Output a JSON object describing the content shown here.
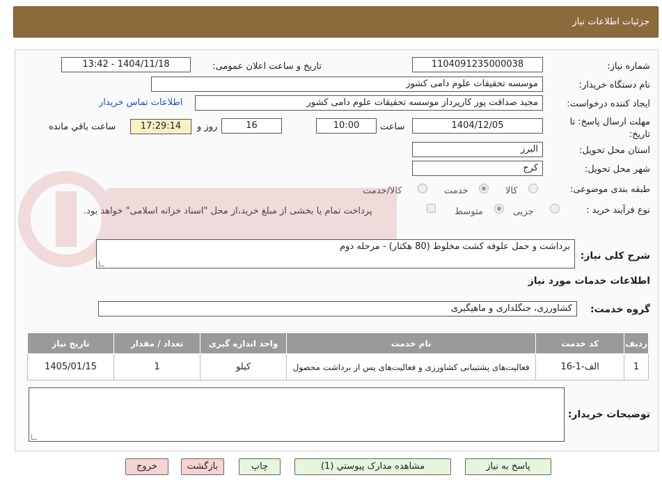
{
  "header": {
    "title": "جزئیات اطلاعات نیاز"
  },
  "form": {
    "need_number": {
      "label": "شماره نیاز:",
      "value": "1104091235000038"
    },
    "announce_datetime": {
      "label": "تاریخ و ساعت اعلان عمومی:",
      "value": "1404/11/18 - 13:42"
    },
    "buyer_org": {
      "label": "نام دستگاه خریدار:",
      "value": "موسسه تحقیقات علوم دامی کشور"
    },
    "requester": {
      "label": "ایجاد کننده درخواست:",
      "value": "مجید صداقت پور کارپرداز موسسه تحقیقات علوم دامی کشور"
    },
    "contact_link": "اطلاعات تماس خریدار",
    "deadline": {
      "label": "مهلت ارسال پاسخ: تا تاریخ:",
      "date": "1404/12/05",
      "time_label": "ساعت",
      "time": "10:00",
      "days": "16",
      "days_label": "روز و",
      "remaining": "17:29:14",
      "remaining_label": "ساعت باقي مانده"
    },
    "province": {
      "label": "استان محل تحویل:",
      "value": "البرز"
    },
    "city": {
      "label": "شهر محل تحویل:",
      "value": "کرج"
    },
    "category": {
      "label": "طبقه بندی موضوعی:",
      "options": [
        "کالا",
        "خدمت",
        "کالا/خدمت"
      ],
      "selected": "خدمت"
    },
    "purchase_type": {
      "label": "نوع فرآیند خرید :",
      "options": [
        "جزیی",
        "متوسط"
      ],
      "selected": "متوسط",
      "note": "پرداخت تمام یا بخشی از مبلغ خرید،از محل \"اسناد خزانه اسلامی\" خواهد بود."
    }
  },
  "description": {
    "label": "شرح کلی نیاز:",
    "value": "برداشت و حمل علوفه کشت مخلوط (80 هکتار) - مرحله دوم"
  },
  "services_section": {
    "title": "اطلاعات خدمات مورد نیاز",
    "group_label": "گروه خدمت:",
    "group_value": "کشاورزی، جنگلداری و ماهیگیری"
  },
  "table": {
    "headers": [
      "ردیف",
      "کد خدمت",
      "نام خدمت",
      "واحد اندازه گیری",
      "تعداد / مقدار",
      "تاریخ نیاز"
    ],
    "rows": [
      [
        "1",
        "الف-1-16",
        "فعالیت‌های پشتیبانی کشاورزی و فعالیت‌های پس از برداشت محصول",
        "کیلو",
        "1",
        "1405/01/15"
      ]
    ]
  },
  "buyer_notes": {
    "label": "توضیحات خریدار:",
    "value": ""
  },
  "buttons": {
    "reply": "پاسخ به نیاز",
    "attachments": "مشاهده مدارک پیوستي (1)",
    "print": "چاپ",
    "back": "بازگشت",
    "exit": "خروج"
  },
  "colors": {
    "header_bg": "#8b6a3c",
    "table_header_bg": "#9a9a9a",
    "link": "#1a4fd8",
    "yellow_box": "#f7f2c4"
  }
}
